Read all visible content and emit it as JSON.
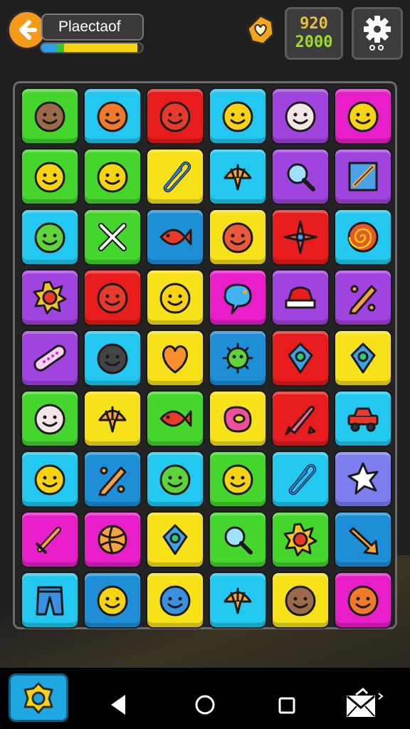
{
  "header": {
    "player_name": "Plaectaof",
    "progress_fraction": 0.95,
    "heart_icon": "heart-badge-icon",
    "score_top": "920",
    "score_bottom": "2000"
  },
  "colors": {
    "background": "#1f1f1f",
    "back_button": "#f39a1a",
    "progress_fill": "#f7d40f",
    "score_top": "#e7c23a",
    "score_bottom": "#9fdc22"
  },
  "board": {
    "rows": 9,
    "cols": 6,
    "tiles": [
      {
        "color": "#44d62c",
        "icon": "face-icon"
      },
      {
        "color": "#22c8ef",
        "icon": "face-icon"
      },
      {
        "color": "#e81c1c",
        "icon": "face-icon"
      },
      {
        "color": "#22c8ef",
        "icon": "face-icon"
      },
      {
        "color": "#a044e0",
        "icon": "face-icon"
      },
      {
        "color": "#e81ec8",
        "icon": "face-icon"
      },
      {
        "color": "#44d62c",
        "icon": "face-icon"
      },
      {
        "color": "#44d62c",
        "icon": "face-icon"
      },
      {
        "color": "#f7e21a",
        "icon": "paperclip-icon"
      },
      {
        "color": "#22c8ef",
        "icon": "shell-icon"
      },
      {
        "color": "#a044e0",
        "icon": "magnifier-icon"
      },
      {
        "color": "#a044e0",
        "icon": "frame-icon"
      },
      {
        "color": "#22c8ef",
        "icon": "face-icon"
      },
      {
        "color": "#44d62c",
        "icon": "tools-icon"
      },
      {
        "color": "#1e8fd6",
        "icon": "fish-icon"
      },
      {
        "color": "#f7e21a",
        "icon": "face-icon"
      },
      {
        "color": "#e81c1c",
        "icon": "sparkle-icon"
      },
      {
        "color": "#22c8ef",
        "icon": "spiral-icon"
      },
      {
        "color": "#a044e0",
        "icon": "sun-icon"
      },
      {
        "color": "#e81c1c",
        "icon": "face-icon"
      },
      {
        "color": "#f7e21a",
        "icon": "face-icon"
      },
      {
        "color": "#e81ec8",
        "icon": "speech-bubble-icon"
      },
      {
        "color": "#a044e0",
        "icon": "hat-icon"
      },
      {
        "color": "#a044e0",
        "icon": "pencil-icon"
      },
      {
        "color": "#a044e0",
        "icon": "bandage-icon"
      },
      {
        "color": "#22c8ef",
        "icon": "face-icon"
      },
      {
        "color": "#f7e21a",
        "icon": "heart-icon"
      },
      {
        "color": "#1e8fd6",
        "icon": "bug-icon"
      },
      {
        "color": "#e81c1c",
        "icon": "gem-icon"
      },
      {
        "color": "#f7e21a",
        "icon": "gem-icon"
      },
      {
        "color": "#44d62c",
        "icon": "face-icon"
      },
      {
        "color": "#f7e21a",
        "icon": "shell-icon"
      },
      {
        "color": "#44d62c",
        "icon": "fish-icon"
      },
      {
        "color": "#f7e21a",
        "icon": "blob-icon"
      },
      {
        "color": "#e81c1c",
        "icon": "rocket-icon"
      },
      {
        "color": "#22c8ef",
        "icon": "car-icon"
      },
      {
        "color": "#22c8ef",
        "icon": "face-icon"
      },
      {
        "color": "#1e8fd6",
        "icon": "pencil-icon"
      },
      {
        "color": "#22c8ef",
        "icon": "face-icon"
      },
      {
        "color": "#44d62c",
        "icon": "face-icon"
      },
      {
        "color": "#22c8ef",
        "icon": "paperclip-icon"
      },
      {
        "color": "#7d7df0",
        "icon": "star-icon"
      },
      {
        "color": "#e81ec8",
        "icon": "sword-icon"
      },
      {
        "color": "#e81ec8",
        "icon": "ball-icon"
      },
      {
        "color": "#f7e21a",
        "icon": "gem-icon"
      },
      {
        "color": "#44d62c",
        "icon": "magnifier-icon"
      },
      {
        "color": "#44d62c",
        "icon": "sun-icon"
      },
      {
        "color": "#1e8fd6",
        "icon": "arrow-icon"
      },
      {
        "color": "#22c8ef",
        "icon": "pants-icon"
      },
      {
        "color": "#1e8fd6",
        "icon": "face-icon"
      },
      {
        "color": "#f7e21a",
        "icon": "face-icon"
      },
      {
        "color": "#22c8ef",
        "icon": "shell-icon"
      },
      {
        "color": "#f7e21a",
        "icon": "face-icon"
      },
      {
        "color": "#e81ec8",
        "icon": "face-icon"
      }
    ]
  },
  "navbar": {
    "power_icon": "power-gem-icon",
    "back_icon": "nav-back-icon",
    "home_icon": "nav-home-icon",
    "recents_icon": "nav-recents-icon",
    "mail_icon": "mail-icon"
  }
}
